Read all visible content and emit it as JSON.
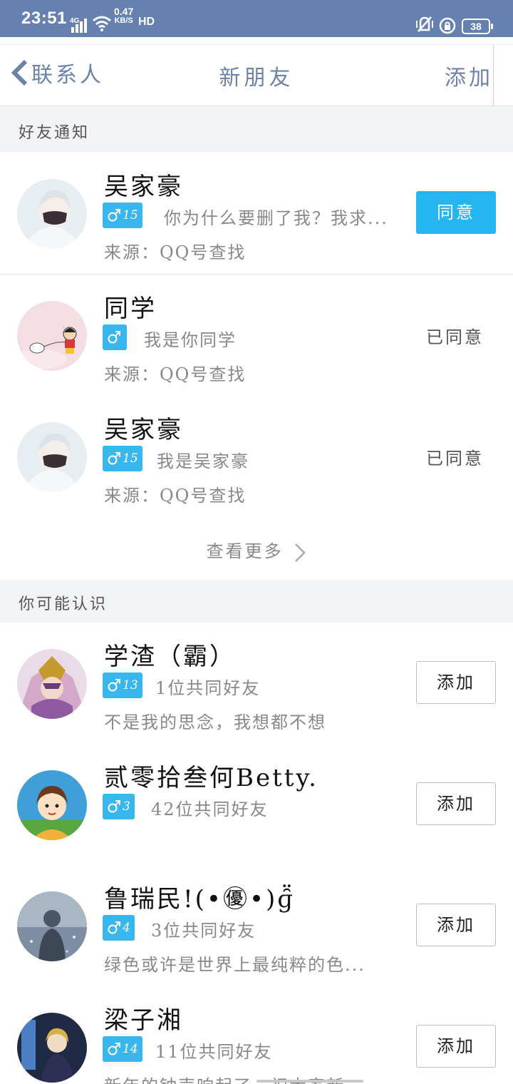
{
  "status_bar": {
    "time": "23:51",
    "network": "4G",
    "speed_value": "0.47",
    "speed_unit": "KB/S",
    "hd": "HD",
    "battery": "38"
  },
  "nav": {
    "back_label": "联系人",
    "title": "新朋友",
    "add_label": "添加"
  },
  "sections": {
    "notifications_title": "好友通知",
    "suggestions_title": "你可能认识"
  },
  "notifications": [
    {
      "name": "吴家豪",
      "age": "15",
      "message": "你为什么要删了我？我求...",
      "source": "来源：QQ号查找",
      "action": "同意"
    },
    {
      "name": "同学",
      "age": "",
      "message": "我是你同学",
      "source": "来源：QQ号查找",
      "action": "已同意"
    },
    {
      "name": "吴家豪",
      "age": "15",
      "message": "我是吴家豪",
      "source": "来源：QQ号查找",
      "action": "已同意"
    }
  ],
  "see_more": "查看更多",
  "suggestions": [
    {
      "name": "学渣（霸）",
      "age": "13",
      "mutual": "1位共同好友",
      "signature": "不是我的思念，我想都不想",
      "action": "添加"
    },
    {
      "name": "贰零拾叁何Betty.",
      "age": "3",
      "mutual": "42位共同好友",
      "signature": "",
      "action": "添加"
    },
    {
      "name": "鲁瑞民!(•㊝•)ɡ̑̈",
      "age": "4",
      "mutual": "3位共同好友",
      "signature": "绿色或许是世界上最纯粹的色...",
      "action": "添加"
    },
    {
      "name": "梁子湘",
      "age": "14",
      "mutual": "11位共同好友",
      "signature": "新年的钟声响起了，祝大家新...",
      "action": "添加"
    }
  ],
  "colors": {
    "status_bar": "#6681b0",
    "nav_text": "#6d82a8",
    "accent_button": "#25b5f0",
    "gender_badge": "#38b6ee"
  }
}
